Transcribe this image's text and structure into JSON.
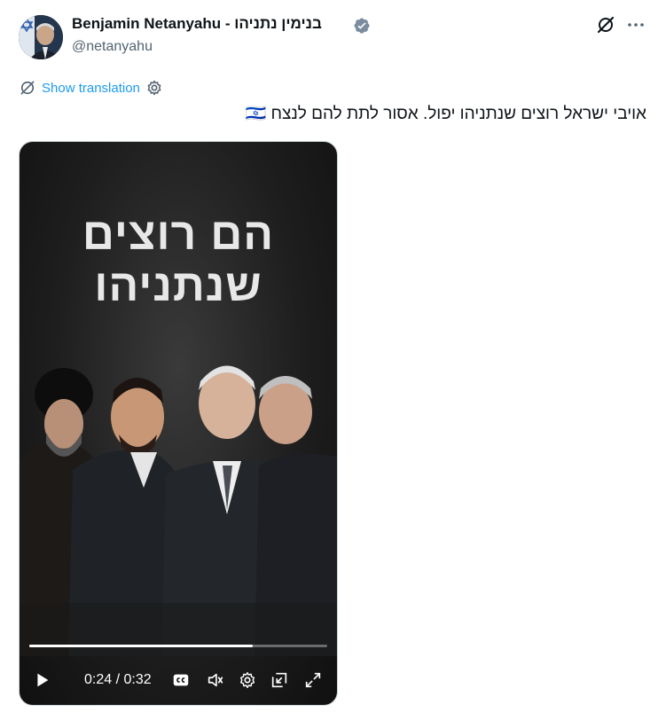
{
  "author": {
    "name": "Benjamin Netanyahu - בנימין נתניהו",
    "handle": "@netanyahu",
    "verified": true,
    "avatar_icon": "avatar-photo"
  },
  "header_icons": [
    "grok-icon",
    "more-icon"
  ],
  "translation": {
    "label": "Show translation",
    "icon": "translate-icon",
    "settings_icon": "gear-icon"
  },
  "tweet": {
    "text": "אויבי ישראל רוצים שנתניהו יפול. אסור לתת להם לנצח 🇮🇱"
  },
  "media": {
    "overlay_title_line1": "הם רוצים",
    "overlay_title_line2": "שנתניהו",
    "progress": 0.75,
    "time_current": "0:24",
    "time_total": "0:32",
    "time_display": "0:24 / 0:32",
    "controls": [
      "play-icon",
      "captions-icon",
      "volume-icon",
      "settings-icon",
      "pip-icon",
      "fullscreen-icon"
    ]
  },
  "colors": {
    "accent": "#1d9bf0",
    "verified": "#7a8c9e",
    "text_primary": "#0f1419",
    "text_secondary": "#536471"
  }
}
